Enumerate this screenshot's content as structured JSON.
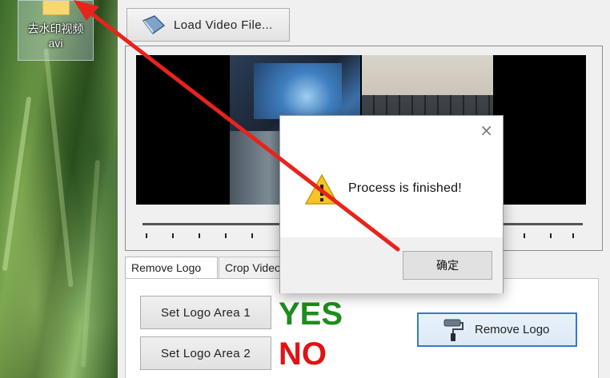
{
  "desktop": {
    "icon_label_line1": "去水印视频",
    "icon_label_line2": "avi",
    "icon": "folder-icon"
  },
  "toolbar": {
    "load_label": "Load Video File...",
    "load_icon": "video-file-icon"
  },
  "preview": {
    "position": 0
  },
  "tabs": [
    {
      "label": "Remove Logo",
      "active": true
    },
    {
      "label": "Crop Video",
      "active": false
    }
  ],
  "remove_logo_tab": {
    "set_area_1": "Set Logo Area 1",
    "set_area_2": "Set Logo Area 2",
    "status_1": "YES",
    "status_2": "NO",
    "remove_button": "Remove Logo",
    "remove_icon": "paint-roller-icon"
  },
  "dialog": {
    "message": "Process is finished!",
    "ok_label": "确定",
    "close": "×",
    "icon": "warning-icon"
  },
  "colors": {
    "yes": "#1e8c1e",
    "no": "#e11212",
    "arrow": "#e8231b",
    "focus_border": "#2e7bd6"
  }
}
